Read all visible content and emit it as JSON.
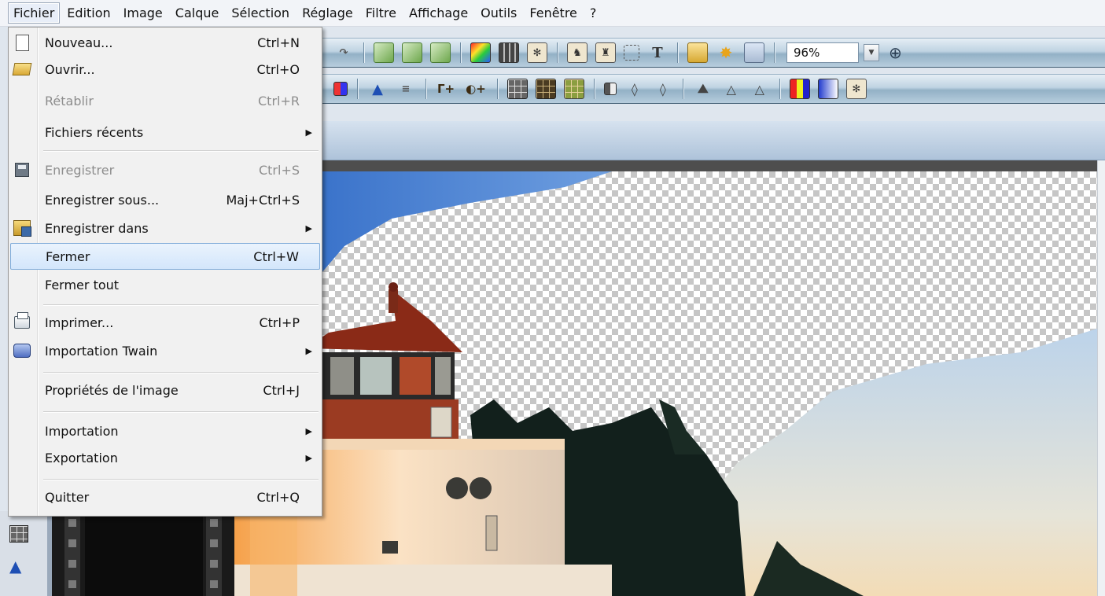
{
  "menubar": {
    "items": [
      "Fichier",
      "Edition",
      "Image",
      "Calque",
      "Sélection",
      "Réglage",
      "Filtre",
      "Affichage",
      "Outils",
      "Fenêtre",
      "?"
    ],
    "active_index": 0
  },
  "toolbar": {
    "zoom_value": "96%"
  },
  "file_menu": {
    "items": [
      {
        "label": "Nouveau...",
        "shortcut": "Ctrl+N",
        "icon": "new-document-icon"
      },
      {
        "label": "Ouvrir...",
        "shortcut": "Ctrl+O",
        "icon": "open-folder-icon"
      },
      {
        "label": "Rétablir",
        "shortcut": "Ctrl+R",
        "disabled": true
      },
      {
        "label": "Fichiers récents",
        "submenu": true
      },
      {
        "label": "Enregistrer",
        "shortcut": "Ctrl+S",
        "disabled": true,
        "icon": "save-disk-icon"
      },
      {
        "label": "Enregistrer sous...",
        "shortcut": "Maj+Ctrl+S"
      },
      {
        "label": "Enregistrer dans",
        "submenu": true,
        "icon": "save-in-folder-icon"
      },
      {
        "label": "Fermer",
        "shortcut": "Ctrl+W",
        "highlighted": true
      },
      {
        "label": "Fermer tout"
      },
      {
        "label": "Imprimer...",
        "shortcut": "Ctrl+P",
        "icon": "printer-icon"
      },
      {
        "label": "Importation Twain",
        "submenu": true,
        "icon": "scanner-icon"
      },
      {
        "label": "Propriétés de l'image",
        "shortcut": "Ctrl+J"
      },
      {
        "label": "Importation",
        "submenu": true
      },
      {
        "label": "Exportation",
        "submenu": true
      },
      {
        "label": "Quitter",
        "shortcut": "Ctrl+Q"
      }
    ],
    "submenu_arrow": "▶"
  },
  "colors": {
    "menu_highlight_border": "#7eaad8",
    "toolbar_dark": "#3f5c72",
    "disabled_text": "#8d8d8d"
  }
}
